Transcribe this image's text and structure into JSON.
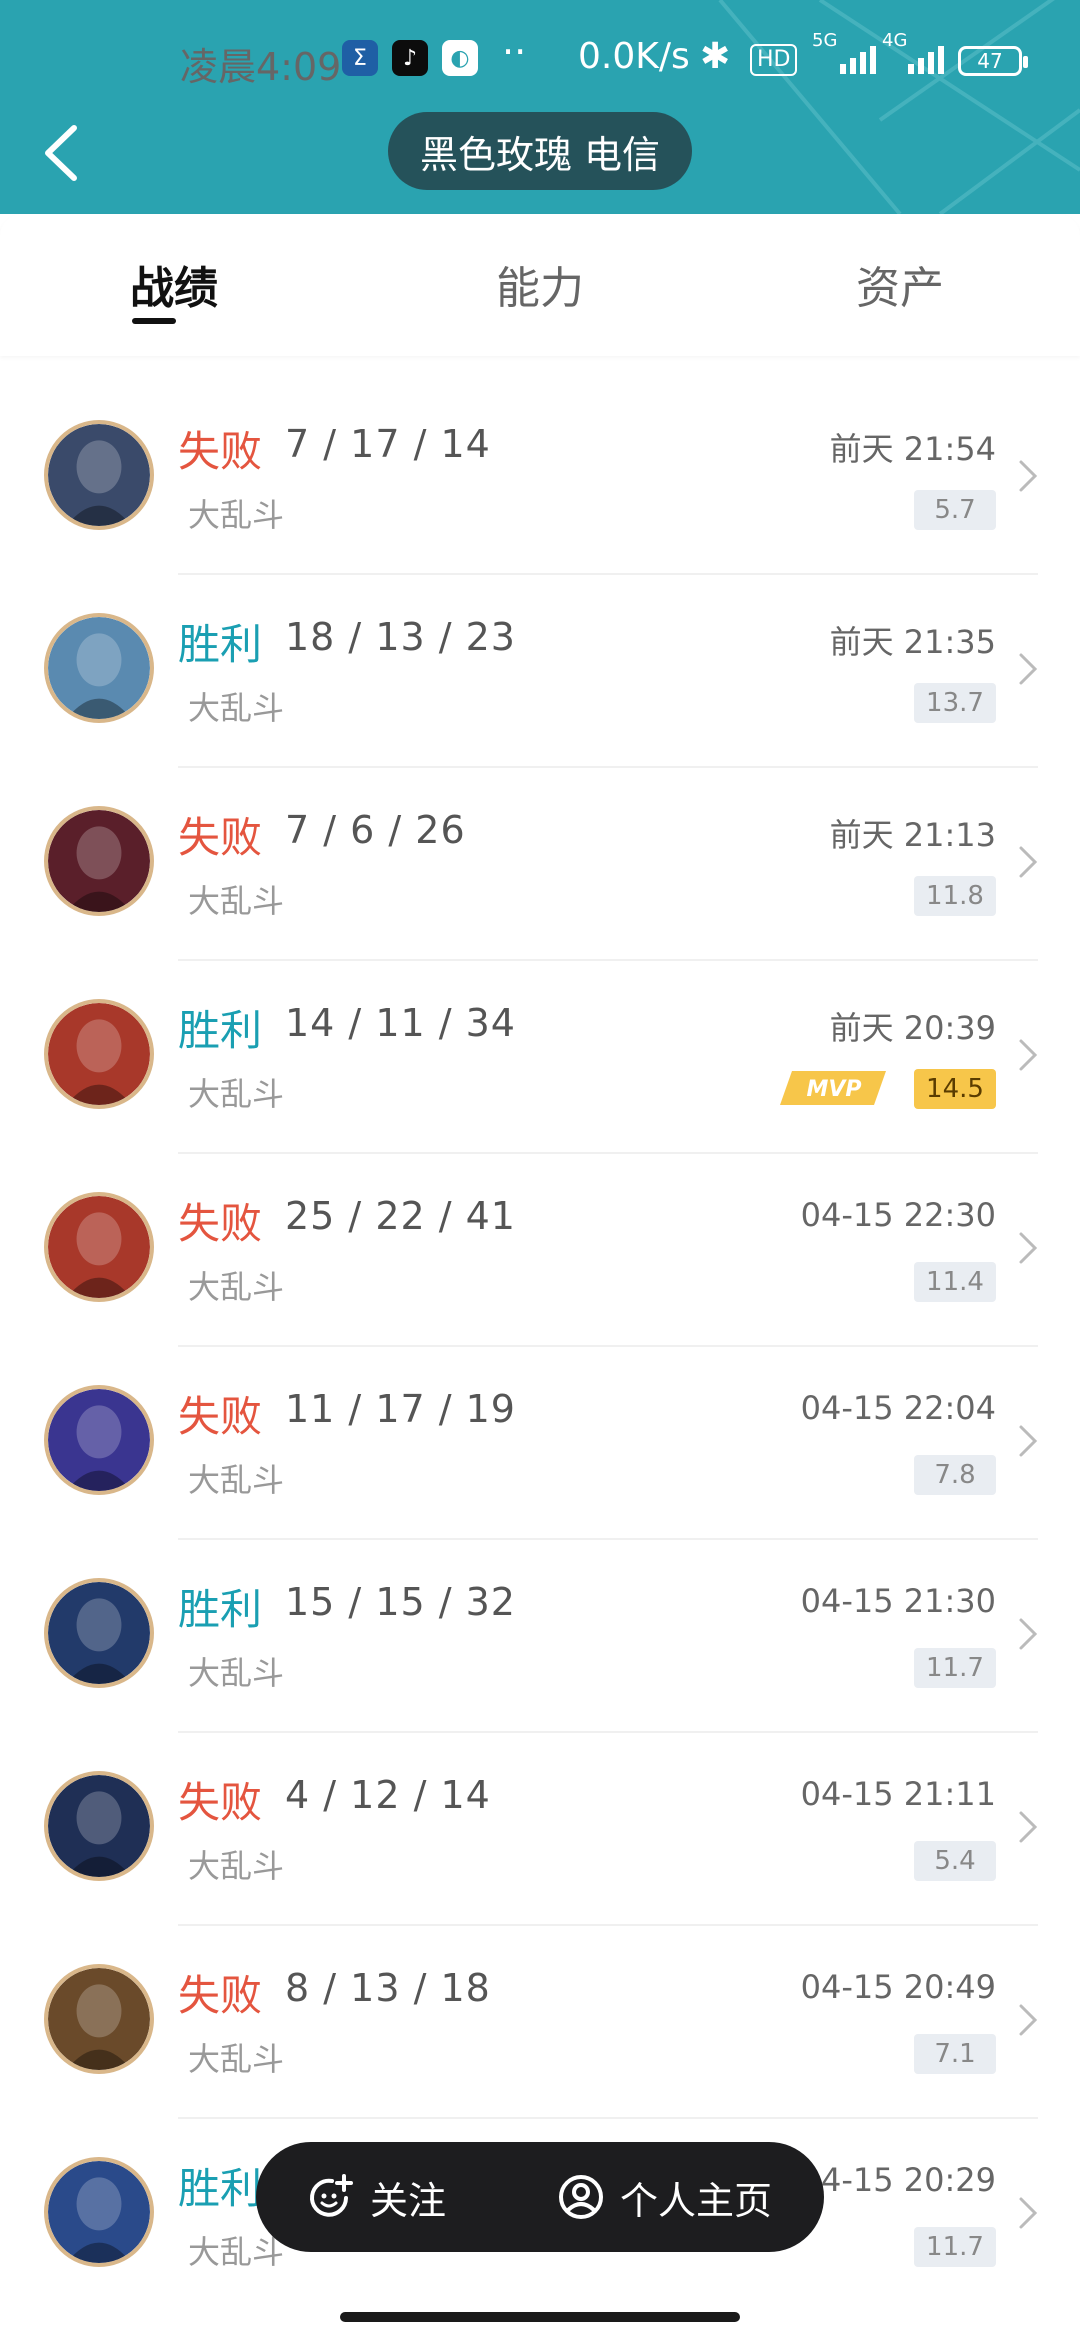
{
  "status_bar": {
    "time": "凌晨4:09",
    "network_speed": "0.0K/s",
    "hd_label": "HD",
    "net1": "5G",
    "net2": "4G",
    "battery": "47"
  },
  "header": {
    "title": "黑色玫瑰 电信"
  },
  "tabs": [
    {
      "label": "战绩",
      "active": true
    },
    {
      "label": "能力",
      "active": false
    },
    {
      "label": "资产",
      "active": false
    }
  ],
  "matches": [
    {
      "result": "失败",
      "outcome": "lose",
      "kda": "7 / 17 / 14",
      "mode": "大乱斗",
      "time": "前天 21:54",
      "score": "5.7",
      "mvp": false,
      "avatar_color": "#3a4a6a"
    },
    {
      "result": "胜利",
      "outcome": "win",
      "kda": "18 / 13 / 23",
      "mode": "大乱斗",
      "time": "前天 21:35",
      "score": "13.7",
      "mvp": false,
      "avatar_color": "#5a8ab0"
    },
    {
      "result": "失败",
      "outcome": "lose",
      "kda": "7 / 6 / 26",
      "mode": "大乱斗",
      "time": "前天 21:13",
      "score": "11.8",
      "mvp": false,
      "avatar_color": "#5a1f2a"
    },
    {
      "result": "胜利",
      "outcome": "win",
      "kda": "14 / 11 / 34",
      "mode": "大乱斗",
      "time": "前天 20:39",
      "score": "14.5",
      "mvp": true,
      "mvp_label": "MVP",
      "avatar_color": "#a8382a"
    },
    {
      "result": "失败",
      "outcome": "lose",
      "kda": "25 / 22 / 41",
      "mode": "大乱斗",
      "time": "04-15 22:30",
      "score": "11.4",
      "mvp": false,
      "avatar_color": "#a8382a"
    },
    {
      "result": "失败",
      "outcome": "lose",
      "kda": "11 / 17 / 19",
      "mode": "大乱斗",
      "time": "04-15 22:04",
      "score": "7.8",
      "mvp": false,
      "avatar_color": "#3a3590"
    },
    {
      "result": "胜利",
      "outcome": "win",
      "kda": "15 / 15 / 32",
      "mode": "大乱斗",
      "time": "04-15 21:30",
      "score": "11.7",
      "mvp": false,
      "avatar_color": "#223a6a"
    },
    {
      "result": "失败",
      "outcome": "lose",
      "kda": "4 / 12 / 14",
      "mode": "大乱斗",
      "time": "04-15 21:11",
      "score": "5.4",
      "mvp": false,
      "avatar_color": "#1f2f55"
    },
    {
      "result": "失败",
      "outcome": "lose",
      "kda": "8 / 13 / 18",
      "mode": "大乱斗",
      "time": "04-15 20:49",
      "score": "7.1",
      "mvp": false,
      "avatar_color": "#6a4a2a"
    },
    {
      "result": "胜利",
      "outcome": "win",
      "kda": "",
      "mode": "大乱斗",
      "time": "04-15 20:29",
      "score": "11.7",
      "mvp": false,
      "avatar_color": "#2a4a8a"
    }
  ],
  "actions": {
    "follow_label": "关注",
    "profile_label": "个人主页"
  },
  "colors": {
    "header_bg": "#2aa3b0",
    "win": "#1a9fb2",
    "lose": "#e4553f",
    "mvp": "#f7c64a"
  }
}
